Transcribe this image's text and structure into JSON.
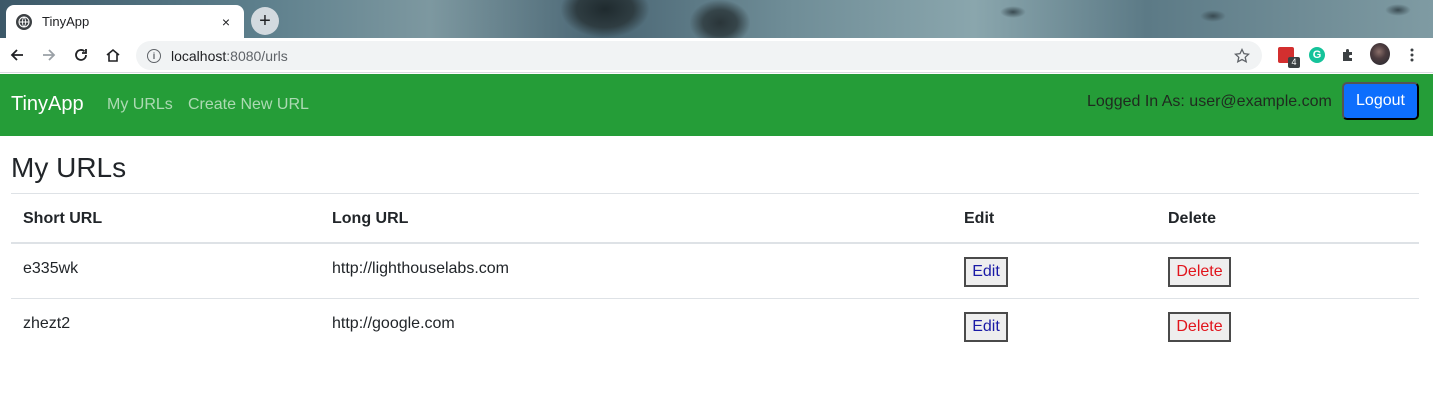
{
  "browser": {
    "tab_title": "TinyApp",
    "tab_close": "×",
    "new_tab": "+",
    "address": {
      "host": "localhost",
      "port_path": ":8080/urls"
    },
    "extension_badge": "4",
    "grammarly_letter": "G"
  },
  "nav": {
    "brand": "TinyApp",
    "links": [
      "My URLs",
      "Create New URL"
    ],
    "logged_in_text": "Logged In As: user@example.com",
    "logout_label": "Logout",
    "bar_color": "#259d38",
    "logout_color": "#0d6efd"
  },
  "main": {
    "title": "My URLs",
    "columns": [
      "Short URL",
      "Long URL",
      "Edit",
      "Delete"
    ],
    "rows": [
      {
        "short": "e335wk",
        "long": "http://lighthouselabs.com",
        "edit": "Edit",
        "delete": "Delete"
      },
      {
        "short": "zhezt2",
        "long": "http://google.com",
        "edit": "Edit",
        "delete": "Delete"
      }
    ]
  }
}
